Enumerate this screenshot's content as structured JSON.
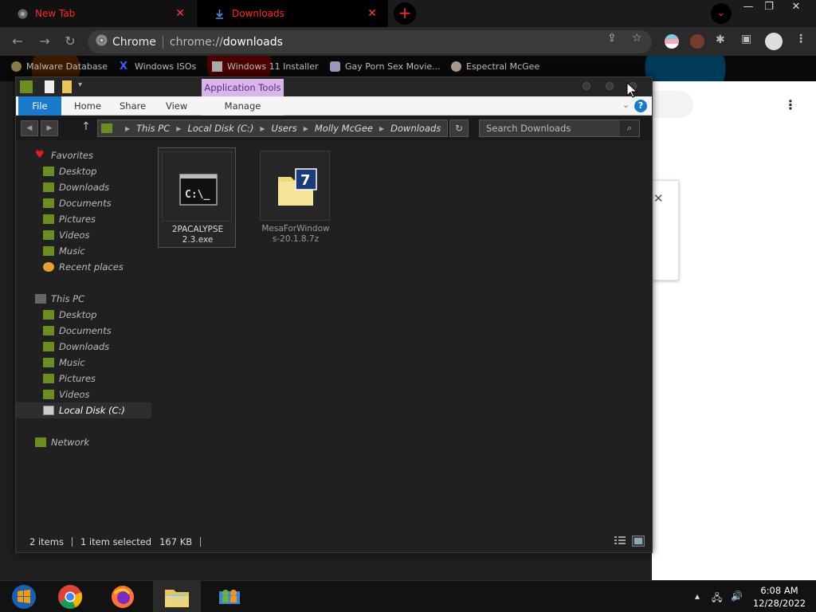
{
  "browser": {
    "tabs": [
      {
        "label": "New Tab",
        "active": false
      },
      {
        "label": "Downloads",
        "active": true
      }
    ],
    "omnibox": {
      "site": "Chrome",
      "url_prefix": "chrome://",
      "url_path": "downloads"
    },
    "bookmarks": [
      {
        "label": "Malware Database"
      },
      {
        "label": "Windows ISOs"
      },
      {
        "label": "Windows 11 Installer"
      },
      {
        "label": "Gay Porn Sex Movie..."
      },
      {
        "label": "Espectral McGee"
      }
    ],
    "window_controls": {
      "minimize": "—",
      "restore": "❐",
      "close": "✕"
    }
  },
  "explorer": {
    "context_tab": "Application Tools",
    "ribbon_tabs": {
      "file": "File",
      "home": "Home",
      "share": "Share",
      "view": "View",
      "manage": "Manage"
    },
    "help": "?",
    "breadcrumb": [
      "This PC",
      "Local Disk (C:)",
      "Users",
      "Molly McGee",
      "Downloads"
    ],
    "search_placeholder": "Search Downloads",
    "nav": {
      "favorites_header": "Favorites",
      "favorites": [
        "Desktop",
        "Downloads",
        "Documents",
        "Pictures",
        "Videos",
        "Music",
        "Recent places"
      ],
      "thispc_header": "This PC",
      "thispc": [
        "Desktop",
        "Documents",
        "Downloads",
        "Music",
        "Pictures",
        "Videos",
        "Local Disk (C:)"
      ],
      "network": "Network"
    },
    "files": [
      {
        "name_line1": "2PACALYPSE",
        "name_line2": "2.3.exe",
        "selected": true
      },
      {
        "name_line1": "MesaForWindow",
        "name_line2": "s-20.1.8.7z",
        "selected": false
      }
    ],
    "status": {
      "items": "2 items",
      "selected": "1 item selected",
      "size": "167 KB"
    }
  },
  "taskbar": {
    "time": "6:08 AM",
    "date": "12/28/2022"
  },
  "colors": {
    "ribbon_file_blue": "#1979ca",
    "app_tools_purple": "#d9b6ea",
    "chrome_tab_red": "#ff2a2a"
  }
}
